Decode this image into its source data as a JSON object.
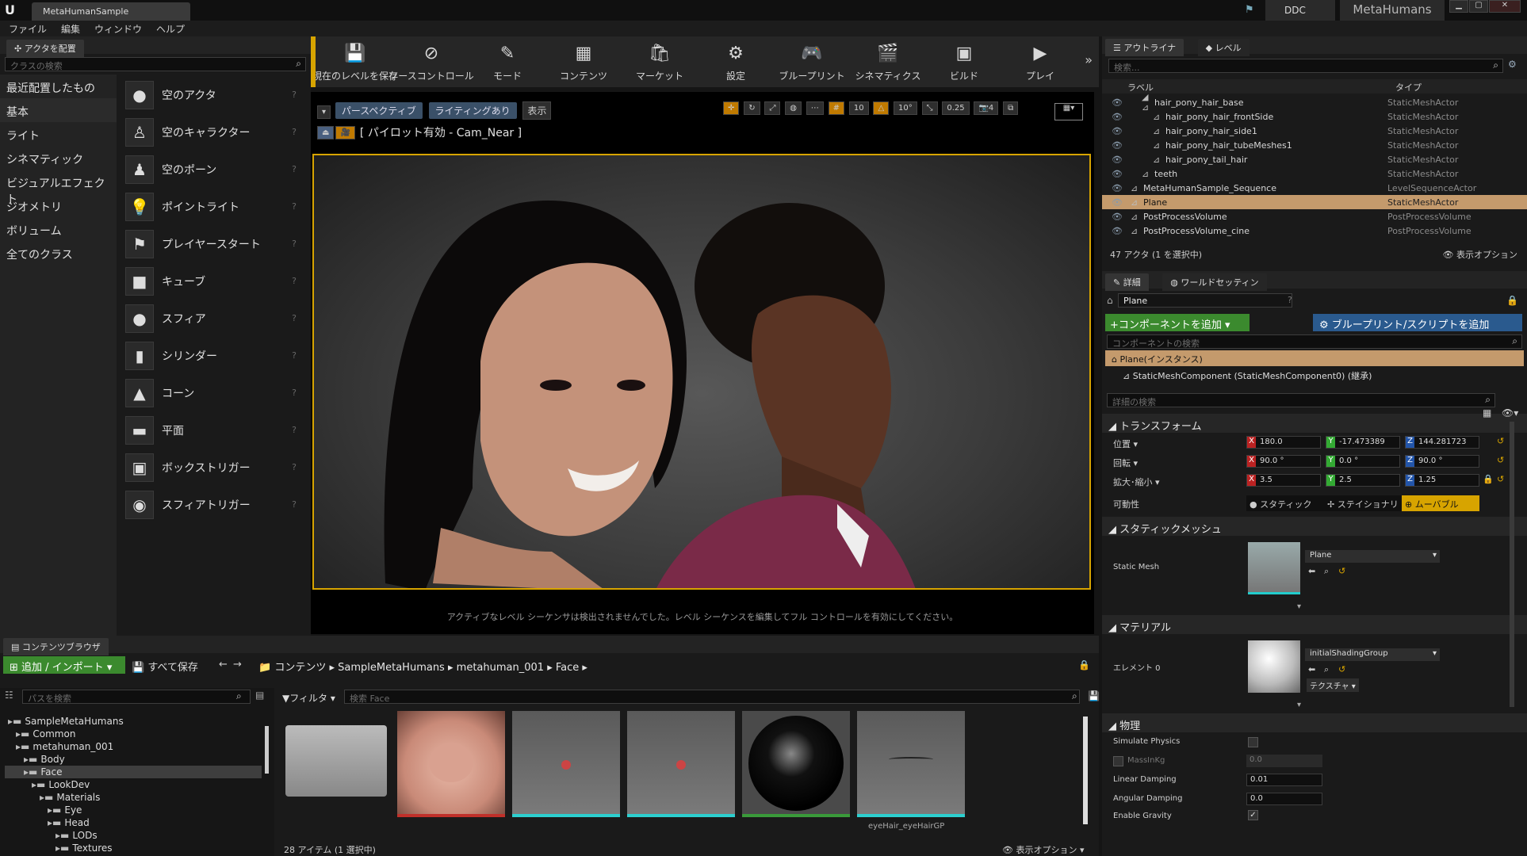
{
  "titlebar": {
    "doc_tab": "MetaHumanSample",
    "ddc": "DDC",
    "project": "MetaHumans"
  },
  "menu": [
    "ファイル",
    "編集",
    "ウィンドウ",
    "ヘルプ"
  ],
  "place_actors": {
    "tab": "アクタを配置",
    "search_placeholder": "クラスの検索",
    "categories": [
      "最近配置したもの",
      "基本",
      "ライト",
      "シネマティック",
      "ビジュアルエフェクト",
      "ジオメトリ",
      "ボリューム",
      "全てのクラス"
    ],
    "items": [
      "空のアクタ",
      "空のキャラクター",
      "空のポーン",
      "ポイントライト",
      "プレイヤースタート",
      "キューブ",
      "スフィア",
      "シリンダー",
      "コーン",
      "平面",
      "ボックストリガー",
      "スフィアトリガー"
    ]
  },
  "toolbar": [
    {
      "label": "現在のレベルを保存",
      "icon": "save-icon",
      "glyph": "💾"
    },
    {
      "label": "ソースコントロール",
      "icon": "source-control-icon",
      "glyph": "⊘"
    },
    {
      "label": "モード",
      "icon": "modes-icon",
      "glyph": "✎"
    },
    {
      "label": "コンテンツ",
      "icon": "content-icon",
      "glyph": "▦"
    },
    {
      "label": "マーケット",
      "icon": "marketplace-icon",
      "glyph": "🛍"
    },
    {
      "label": "設定",
      "icon": "settings-icon",
      "glyph": "⚙"
    },
    {
      "label": "ブループリント",
      "icon": "blueprint-icon",
      "glyph": "🎮"
    },
    {
      "label": "シネマティクス",
      "icon": "cinematics-icon",
      "glyph": "🎬"
    },
    {
      "label": "ビルド",
      "icon": "build-icon",
      "glyph": "▣"
    },
    {
      "label": "プレイ",
      "icon": "play-icon",
      "glyph": "▶"
    }
  ],
  "viewport": {
    "perspective": "パースペクティブ",
    "lighting": "ライティングあり",
    "show": "表示",
    "pilot": "[ パイロット有効 - Cam_Near ]",
    "grid_snap": "10",
    "rot_snap": "10°",
    "scale_snap": "0.25",
    "cam_speed": "4",
    "sequencer_msg": "アクティブなレベル シーケンサは検出されませんでした。レベル シーケンスを編集してフル コントロールを有効にしてください。"
  },
  "outliner": {
    "tab": "アウトライナ",
    "level_tab": "レベル",
    "search_placeholder": "検索...",
    "col_label": "ラベル",
    "col_type": "タイプ",
    "rows": [
      {
        "label": "hair_pony_hair_base",
        "type": "StaticMeshActor",
        "indent": 1
      },
      {
        "label": "hair_pony_hair_frontSide",
        "type": "StaticMeshActor",
        "indent": 2
      },
      {
        "label": "hair_pony_hair_side1",
        "type": "StaticMeshActor",
        "indent": 2
      },
      {
        "label": "hair_pony_hair_tubeMeshes1",
        "type": "StaticMeshActor",
        "indent": 2
      },
      {
        "label": "hair_pony_tail_hair",
        "type": "StaticMeshActor",
        "indent": 2
      },
      {
        "label": "teeth",
        "type": "StaticMeshActor",
        "indent": 1
      },
      {
        "label": "MetaHumanSample_Sequence",
        "type": "LevelSequenceActor",
        "indent": 0
      },
      {
        "label": "Plane",
        "type": "StaticMeshActor",
        "indent": 0,
        "selected": true
      },
      {
        "label": "PostProcessVolume",
        "type": "PostProcessVolume",
        "indent": 0
      },
      {
        "label": "PostProcessVolume_cine",
        "type": "PostProcessVolume",
        "indent": 0
      }
    ],
    "footer": "47 アクタ (1 を選択中)",
    "view_options": "表示オプション"
  },
  "details": {
    "tab": "詳細",
    "world_tab": "ワールドセッティン",
    "name": "Plane",
    "add_component": "+コンポーネントを追加",
    "add_blueprint": "ブループリント/スクリプトを追加",
    "component_search": "コンポーネントの検索",
    "instance": "Plane(インスタンス)",
    "component": "StaticMeshComponent (StaticMeshComponent0) (継承)",
    "details_search": "詳細の検索",
    "transform": {
      "title": "トランスフォーム",
      "location_label": "位置",
      "rotation_label": "回転",
      "scale_label": "拡大･縮小",
      "mobility_label": "可動性",
      "location": [
        "180.0",
        "-17.473389",
        "144.281723"
      ],
      "rotation": [
        "90.0 °",
        "0.0 °",
        "90.0 °"
      ],
      "scale": [
        "3.5",
        "2.5",
        "1.25"
      ],
      "mobility": [
        "スタティック",
        "ステイショナリ",
        "ムーバブル"
      ]
    },
    "static_mesh": {
      "title": "スタティックメッシュ",
      "label": "Static Mesh",
      "value": "Plane"
    },
    "materials": {
      "title": "マテリアル",
      "label": "エレメント 0",
      "value": "initialShadingGroup",
      "textures": "テクスチャ"
    },
    "physics": {
      "title": "物理",
      "simulate": "Simulate Physics",
      "mass": "MassInKg",
      "mass_value": "0.0",
      "linear": "Linear Damping",
      "linear_value": "0.01",
      "angular": "Angular Damping",
      "angular_value": "0.0",
      "gravity": "Enable Gravity"
    }
  },
  "content_browser": {
    "tab": "コンテンツブラウザ",
    "add_import": "追加 / インポート",
    "save_all": "すべて保存",
    "path": [
      "コンテンツ",
      "SampleMetaHumans",
      "metahuman_001",
      "Face"
    ],
    "path_search": "パスを検索",
    "filter": "フィルタ",
    "asset_search": "検索 Face",
    "tree": [
      {
        "label": "SampleMetaHumans",
        "level": 0
      },
      {
        "label": "Common",
        "level": 1
      },
      {
        "label": "metahuman_001",
        "level": 1
      },
      {
        "label": "Body",
        "level": 2
      },
      {
        "label": "Face",
        "level": 2,
        "selected": true
      },
      {
        "label": "LookDev",
        "level": 3
      },
      {
        "label": "Materials",
        "level": 4
      },
      {
        "label": "Eye",
        "level": 5
      },
      {
        "label": "Head",
        "level": 5
      },
      {
        "label": "LODs",
        "level": 6
      },
      {
        "label": "Textures",
        "level": 6
      }
    ],
    "footer": "28 アイテム (1 選択中)",
    "view_options": "表示オプション",
    "last_asset_label": "eyeHair_eyeHairGP"
  }
}
